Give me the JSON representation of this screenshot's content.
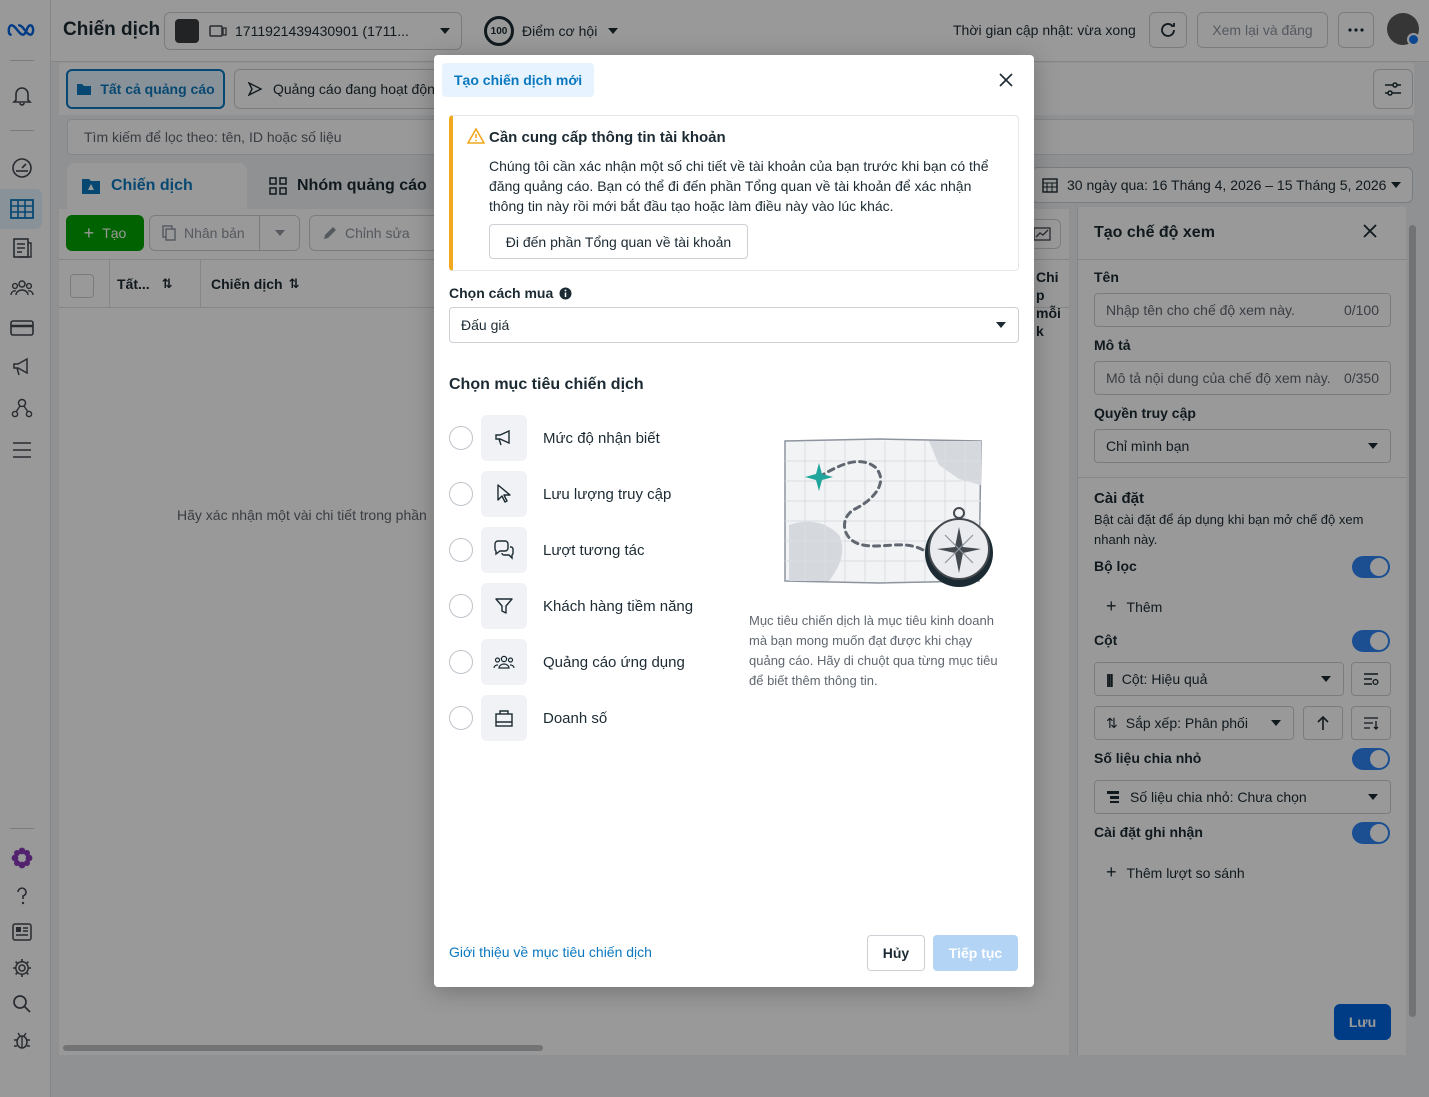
{
  "topbar": {
    "title": "Chiến dịch",
    "account": "1711921439430901 (1711...",
    "opportunity_score": "100",
    "opportunity_label": "Điểm cơ hội",
    "update_time": "Thời gian cập nhật: vừa xong",
    "review_publish": "Xem lại và đăng"
  },
  "filters": {
    "all_ads": "Tất cả quảng cáo",
    "active_ads": "Quảng cáo đang hoạt độn",
    "search_placeholder": "Tìm kiếm để lọc theo: tên, ID hoặc số liệu"
  },
  "tabs": {
    "campaigns": "Chiến dịch",
    "adsets": "Nhóm quảng cáo"
  },
  "date_range": "30 ngày qua: 16 Tháng 4, 2026 – 15 Tháng 5, 2026",
  "toolbar": {
    "create": "Tạo",
    "duplicate": "Nhân bản",
    "edit": "Chỉnh sửa"
  },
  "table": {
    "col_all": "Tất...",
    "col_campaign": "Chiến dịch",
    "col_cost_a": "Chi p",
    "col_cost_b": "mỗi k",
    "empty_message": "Hãy xác nhận một vài chi tiết trong phần"
  },
  "modal": {
    "tab_label": "Tạo chiến dịch mới",
    "alert_title": "Cần cung cấp thông tin tài khoản",
    "alert_body": "Chúng tôi cần xác nhận một số chi tiết về tài khoản của bạn trước khi bạn có thể đăng quảng cáo. Bạn có thể đi đến phần Tổng quan về tài khoản để xác nhận thông tin này rồi mới bắt đầu tạo hoặc làm điều này vào lúc khác.",
    "alert_button": "Đi đến phần Tổng quan về tài khoản",
    "buy_label": "Chọn cách mua",
    "buy_value": "Đấu giá",
    "objective_heading": "Chọn mục tiêu chiến dịch",
    "objectives": [
      {
        "label": "Mức độ nhận biết",
        "icon": "megaphone-icon"
      },
      {
        "label": "Lưu lượng truy cập",
        "icon": "cursor-icon"
      },
      {
        "label": "Lượt tương tác",
        "icon": "chat-bubbles-icon"
      },
      {
        "label": "Khách hàng tiềm năng",
        "icon": "funnel-icon"
      },
      {
        "label": "Quảng cáo ứng dụng",
        "icon": "people-icon"
      },
      {
        "label": "Doanh số",
        "icon": "shopping-bag-icon"
      }
    ],
    "objective_description": "Mục tiêu chiến dịch là mục tiêu kinh doanh mà bạn mong muốn đạt được khi chạy quảng cáo. Hãy di chuột qua từng mục tiêu để biết thêm thông tin.",
    "about_link": "Giới thiệu về mục tiêu chiến dịch",
    "cancel": "Hủy",
    "continue": "Tiếp tục"
  },
  "view_panel": {
    "title": "Tạo chế độ xem",
    "name_label": "Tên",
    "name_placeholder": "Nhập tên cho chế độ xem này.",
    "name_count": "0/100",
    "desc_label": "Mô tả",
    "desc_placeholder": "Mô tả nội dung của chế độ xem này.",
    "desc_count": "0/350",
    "access_label": "Quyền truy cập",
    "access_value": "Chỉ mình bạn",
    "settings_label": "Cài đặt",
    "settings_desc": "Bật cài đặt để áp dụng khi bạn mở chế độ xem nhanh này.",
    "filter_label": "Bộ lọc",
    "add_label": "Thêm",
    "columns_label": "Cột",
    "columns_value": "Cột: Hiệu quả",
    "sort_value": "Sắp xếp: Phân phối",
    "breakdown_label": "Số liệu chia nhỏ",
    "breakdown_value": "Số liệu chia nhỏ: Chưa chọn",
    "attribution_label": "Cài đặt ghi nhận",
    "add_compare": "Thêm lượt so sánh",
    "save": "Lưu"
  },
  "colors": {
    "accent": "#0a78be",
    "primary": "#0064e0",
    "warning": "#f7b928"
  }
}
